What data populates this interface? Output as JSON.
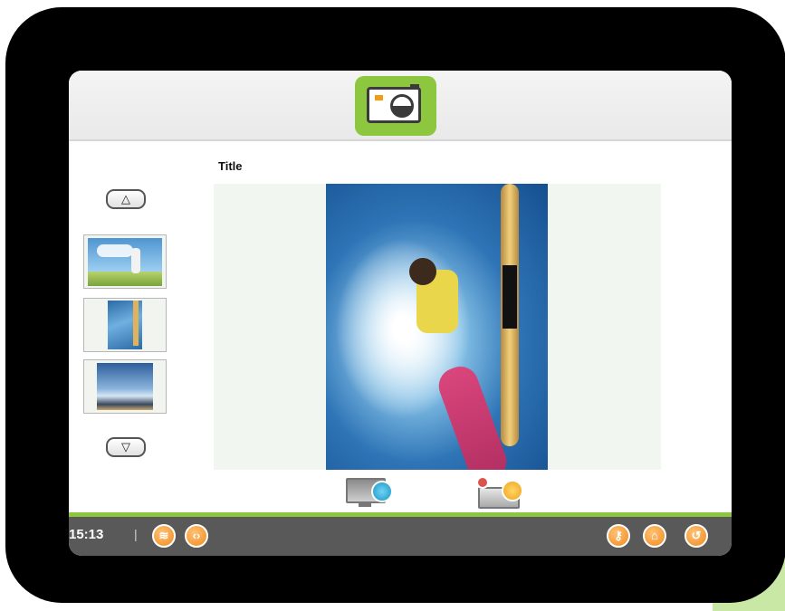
{
  "header": {
    "app_icon": "camera-icon"
  },
  "gallery": {
    "title": "Title",
    "scroll_up_label": "△",
    "scroll_down_label": "▽",
    "thumbnails": [
      {
        "name": "thumbnail-field"
      },
      {
        "name": "thumbnail-windsurfer"
      },
      {
        "name": "thumbnail-sky"
      }
    ],
    "actions": [
      {
        "icon": "monitor-play-icon"
      },
      {
        "icon": "network-share-icon"
      }
    ]
  },
  "taskbar": {
    "time": "15:13",
    "separator": "|",
    "left_icons": [
      "wifi-icon",
      "code-icon"
    ],
    "right_icons": [
      "key-icon",
      "home-icon",
      "back-icon"
    ]
  },
  "colors": {
    "accent_green": "#8dc63f",
    "taskbar_bg": "#595959",
    "orange": "#f08a1c"
  }
}
